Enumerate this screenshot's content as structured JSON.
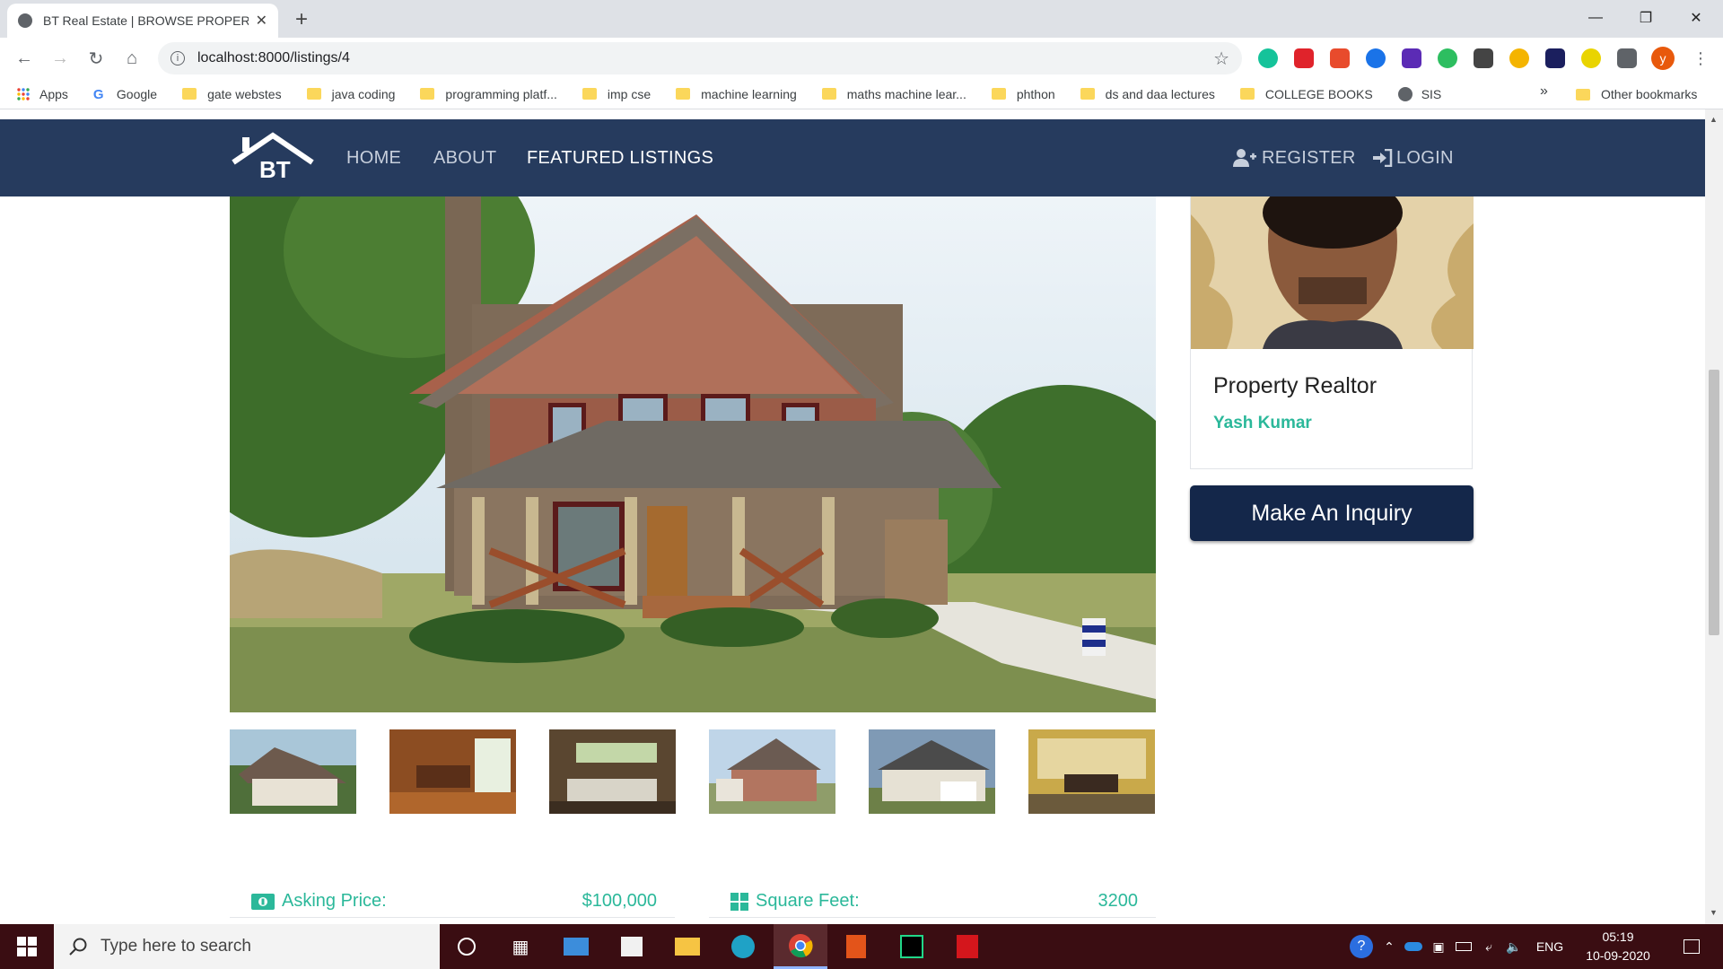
{
  "browser": {
    "tab_title": "BT Real Estate | BROWSE PROPERTY",
    "tab_close": "✕",
    "new_tab": "+",
    "url": "localhost:8000/listings/4",
    "profile_initial": "y"
  },
  "bookmarks": [
    {
      "label": "Apps",
      "icon": "apps-grid-icon"
    },
    {
      "label": "Google",
      "icon": "google-icon"
    },
    {
      "label": "gate webstes",
      "icon": "folder-icon"
    },
    {
      "label": "java coding",
      "icon": "folder-icon"
    },
    {
      "label": "programming platf...",
      "icon": "folder-icon"
    },
    {
      "label": "imp cse",
      "icon": "folder-icon"
    },
    {
      "label": "machine learning",
      "icon": "folder-icon"
    },
    {
      "label": "maths machine lear...",
      "icon": "folder-icon"
    },
    {
      "label": "phthon",
      "icon": "folder-icon"
    },
    {
      "label": "ds and daa lectures",
      "icon": "folder-icon"
    },
    {
      "label": "COLLEGE BOOKS",
      "icon": "folder-icon"
    },
    {
      "label": "SIS",
      "icon": "globe-icon"
    }
  ],
  "bookmarks_more": "»",
  "other_bookmarks": "Other bookmarks",
  "site": {
    "logo_text": "BT",
    "nav": {
      "home": "HOME",
      "about": "ABOUT",
      "featured": "FEATURED LISTINGS",
      "register": "REGISTER",
      "login": "LOGIN"
    }
  },
  "realtor": {
    "title": "Property Realtor",
    "name": "Yash Kumar"
  },
  "inquiry_button": "Make An Inquiry",
  "details": [
    {
      "label": "Asking Price:",
      "value": "$100,000",
      "icon": "money-icon"
    },
    {
      "label": "Square Feet:",
      "value": "3200",
      "icon": "grid-icon"
    }
  ],
  "taskbar": {
    "search_placeholder": "Type here to search",
    "language": "ENG",
    "time": "05:19",
    "date": "10-09-2020"
  },
  "colors": {
    "navbar": "#263b5e",
    "accent": "#2bb89a",
    "button": "#14274a"
  }
}
